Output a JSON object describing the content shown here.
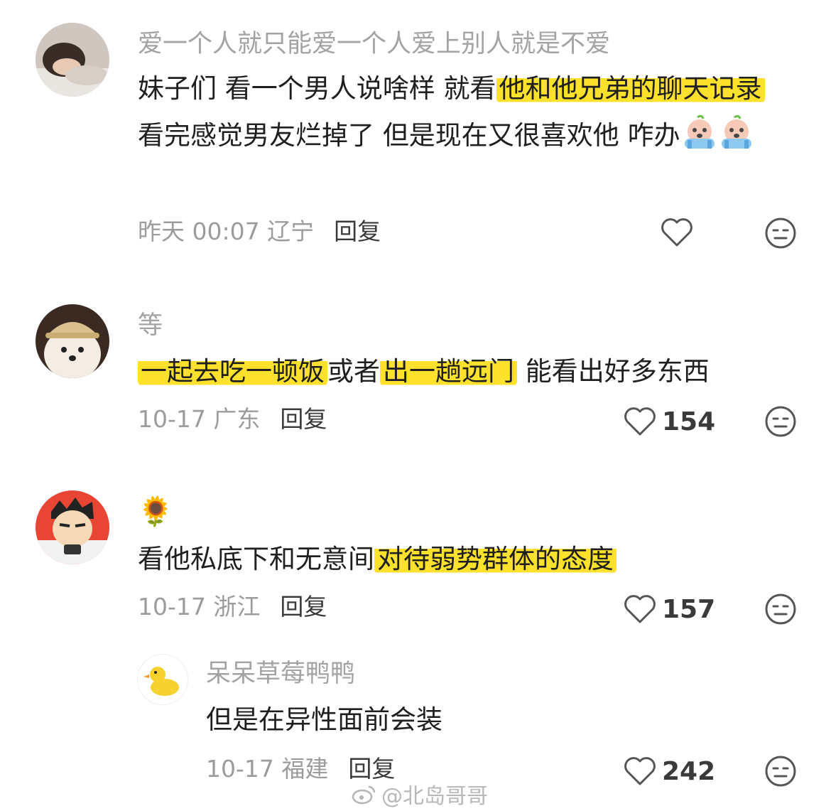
{
  "comments": [
    {
      "name": "爱一个人就只能爱一个人爱上别人就是不爱",
      "text_parts": [
        {
          "text": "妹子们 看一个男人说啥样 就看",
          "highlight": false
        },
        {
          "text": "他和他兄弟的聊天记录",
          "highlight": true
        },
        {
          "text": " 看完感觉男友烂掉了 但是现在又很喜欢他 咋办",
          "highlight": false
        }
      ],
      "time_location": "昨天 00:07 辽宁",
      "reply_label": "回复",
      "like_count": "",
      "avatar_icon": "sleeping-person-avatar"
    },
    {
      "name": "等",
      "text_parts": [
        {
          "text": "一起去吃一顿饭",
          "highlight": true
        },
        {
          "text": "或者",
          "highlight": false
        },
        {
          "text": "出一趟远门",
          "highlight": true
        },
        {
          "text": " 能看出好多东西",
          "highlight": false
        }
      ],
      "time_location": "10-17 广东",
      "reply_label": "回复",
      "like_count": "154",
      "avatar_icon": "puppy-hat-avatar"
    },
    {
      "name": "🌻",
      "text_parts": [
        {
          "text": "看他私底下和无意间",
          "highlight": false
        },
        {
          "text": "对待弱势群体的态度",
          "highlight": true
        }
      ],
      "time_location": "10-17 浙江",
      "reply_label": "回复",
      "like_count": "157",
      "avatar_icon": "cartoon-man-avatar"
    },
    {
      "name": "呆呆草莓鸭鸭",
      "text_parts": [
        {
          "text": "但是在异性面前会装",
          "highlight": false
        }
      ],
      "time_location": "10-17 福建",
      "reply_label": "回复",
      "like_count": "242",
      "avatar_icon": "duck-avatar"
    }
  ],
  "watermark": "@北岛哥哥",
  "colors": {
    "highlight": "#fde12c",
    "meta_gray": "#9c9c9c",
    "name_gray": "#a3a3a3",
    "text": "#1f1f1f"
  },
  "icons": [
    "heart-icon",
    "dislike-face-icon",
    "crying-face-emoji",
    "weibo-icon"
  ]
}
